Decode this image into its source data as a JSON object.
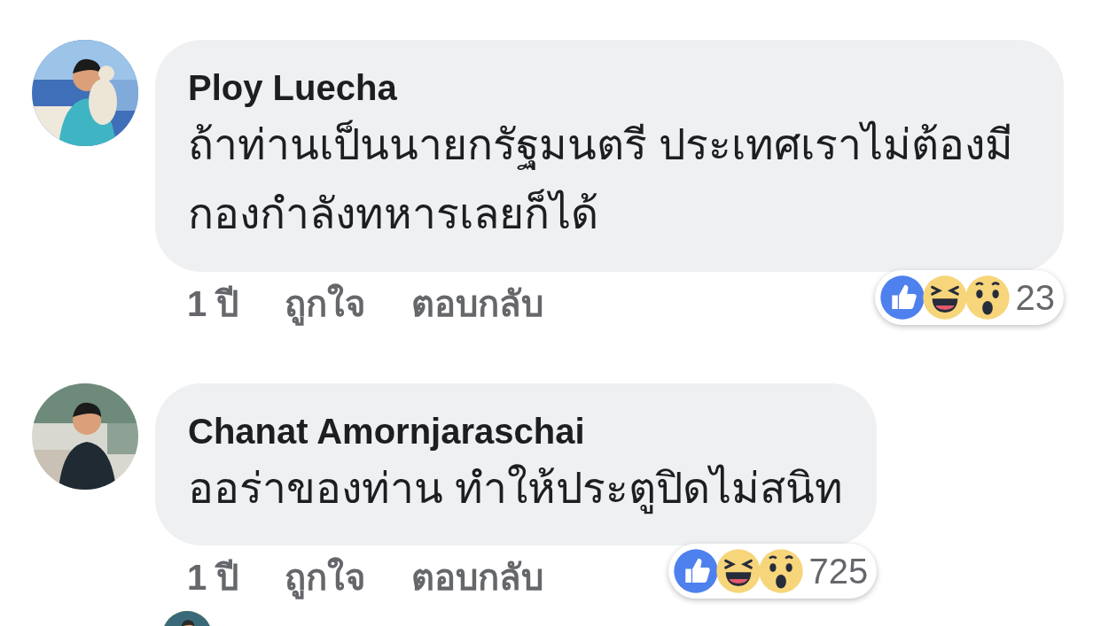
{
  "comments": [
    {
      "kind": "comment",
      "author": "Ploy Luecha",
      "text": "ถ้าท่านเป็นนายกรัฐมนตรี ประเทศเราไม่ต้องมีกองกำลังทหารเลยก็ได้",
      "actions": [
        "1 ปี",
        "ถูกใจ",
        "ตอบกลับ"
      ],
      "reactions": [
        {
          "kind": "like"
        },
        {
          "kind": "haha"
        },
        {
          "kind": "wow"
        }
      ],
      "reaction_count": "23"
    },
    {
      "kind": "comment",
      "author": "Chanat Amornjaraschai",
      "text": "ออร่าของท่าน ทำให้ประตูปิดไม่สนิท",
      "actions": [
        "1 ปี",
        "ถูกใจ",
        "ตอบกลับ"
      ],
      "reactions": [
        {
          "kind": "like"
        },
        {
          "kind": "haha"
        },
        {
          "kind": "wow"
        }
      ],
      "reaction_count": "725"
    },
    {
      "kind": "reply"
    }
  ]
}
